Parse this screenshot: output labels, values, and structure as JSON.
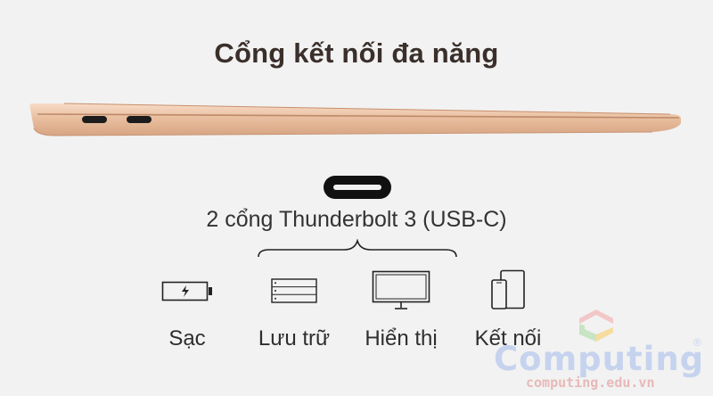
{
  "title": "Cổng kết nối đa năng",
  "port_label": "2 cổng Thunderbolt 3 (USB-C)",
  "features": [
    {
      "label": "Sạc",
      "icon": "battery-charging-icon"
    },
    {
      "label": "Lưu trữ",
      "icon": "storage-icon"
    },
    {
      "label": "Hiển thị",
      "icon": "monitor-icon"
    },
    {
      "label": "Kết nối",
      "icon": "devices-icon"
    }
  ],
  "watermark": {
    "brand": "Computing",
    "url": "computing.edu.vn",
    "registered": "®"
  },
  "colors": {
    "background": "#f2f2f2",
    "laptop_gold": "#e8c3a8",
    "title": "#3a2f2a"
  }
}
